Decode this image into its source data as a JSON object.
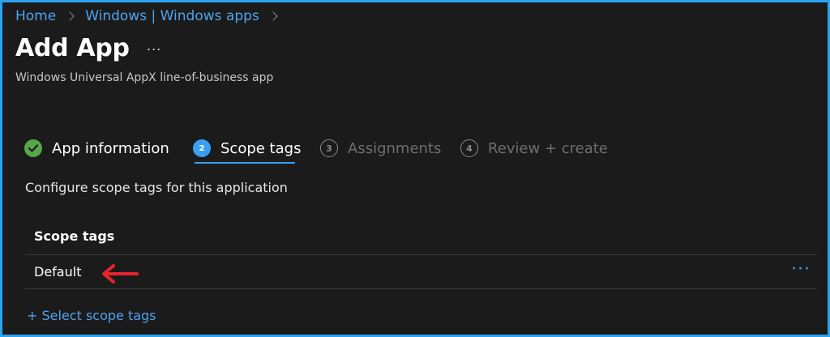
{
  "breadcrumb": {
    "items": [
      "Home",
      "Windows | Windows apps"
    ]
  },
  "header": {
    "title": "Add App",
    "more_label": "...",
    "subtitle": "Windows Universal AppX line-of-business app"
  },
  "wizard": {
    "steps": [
      {
        "number": "",
        "label": "App information",
        "state": "done"
      },
      {
        "number": "2",
        "label": "Scope tags",
        "state": "current"
      },
      {
        "number": "3",
        "label": "Assignments",
        "state": "pending"
      },
      {
        "number": "4",
        "label": "Review + create",
        "state": "pending"
      }
    ]
  },
  "main": {
    "description": "Configure scope tags for this application",
    "table": {
      "header": "Scope tags",
      "rows": [
        {
          "value": "Default",
          "actions_label": "···"
        }
      ]
    },
    "select_link": "+ Select scope tags"
  },
  "colors": {
    "accent": "#3aa0f3",
    "link": "#4ea3ee",
    "done": "#57a64a",
    "annotation_arrow": "#e8242b",
    "frame_border": "#2aa3f0",
    "background": "#1b1b1b"
  },
  "icons": {
    "done_badge": "checkmark-icon",
    "annotation": "left-arrow-icon"
  }
}
